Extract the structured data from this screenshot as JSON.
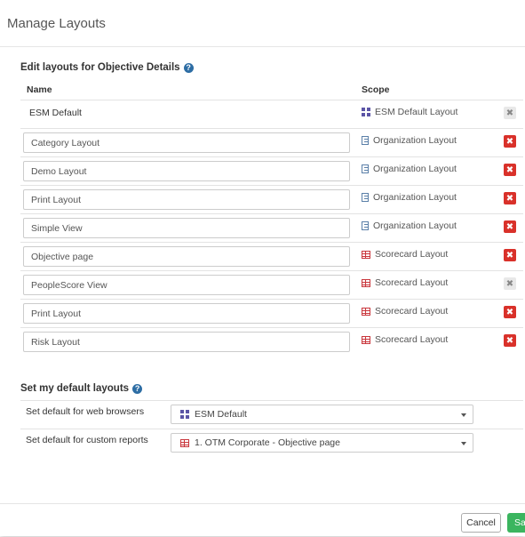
{
  "modal": {
    "title": "Manage Layouts",
    "edit_heading": "Edit layouts for Objective Details",
    "columns": {
      "name": "Name",
      "scope": "Scope"
    },
    "layouts": [
      {
        "name": "ESM Default",
        "editable": false,
        "scope": "ESM Default Layout",
        "scope_icon": "grid-icon",
        "deletable": false
      },
      {
        "name": "Category Layout",
        "editable": true,
        "scope": "Organization Layout",
        "scope_icon": "organization-icon",
        "deletable": true
      },
      {
        "name": "Demo Layout",
        "editable": true,
        "scope": "Organization Layout",
        "scope_icon": "organization-icon",
        "deletable": true
      },
      {
        "name": "Print Layout",
        "editable": true,
        "scope": "Organization Layout",
        "scope_icon": "organization-icon",
        "deletable": true
      },
      {
        "name": "Simple View",
        "editable": true,
        "scope": "Organization Layout",
        "scope_icon": "organization-icon",
        "deletable": true
      },
      {
        "name": "Objective page",
        "editable": true,
        "scope": "Scorecard Layout",
        "scope_icon": "scorecard-icon",
        "deletable": true
      },
      {
        "name": "PeopleScore View",
        "editable": true,
        "scope": "Scorecard Layout",
        "scope_icon": "scorecard-icon",
        "deletable": false
      },
      {
        "name": "Print Layout",
        "editable": true,
        "scope": "Scorecard Layout",
        "scope_icon": "scorecard-icon",
        "deletable": true
      },
      {
        "name": "Risk Layout",
        "editable": true,
        "scope": "Scorecard Layout",
        "scope_icon": "scorecard-icon",
        "deletable": true
      }
    ],
    "defaults_heading": "Set my default layouts",
    "defaults": [
      {
        "label": "Set default for web browsers",
        "value": "ESM Default",
        "icon": "grid-icon"
      },
      {
        "label": "Set default for custom reports",
        "value": "1. OTM Corporate - Objective page",
        "icon": "scorecard-icon"
      }
    ],
    "footer": {
      "cancel_label": "Cancel",
      "save_label": "Save"
    }
  },
  "colors": {
    "delete": "#d9312a",
    "delete_disabled": "#e8e8e8",
    "save": "#3bb55f",
    "help": "#2d6da4",
    "scorecard": "#c9363c",
    "esm": "#5b54a6",
    "org": "#5a7fa8"
  }
}
